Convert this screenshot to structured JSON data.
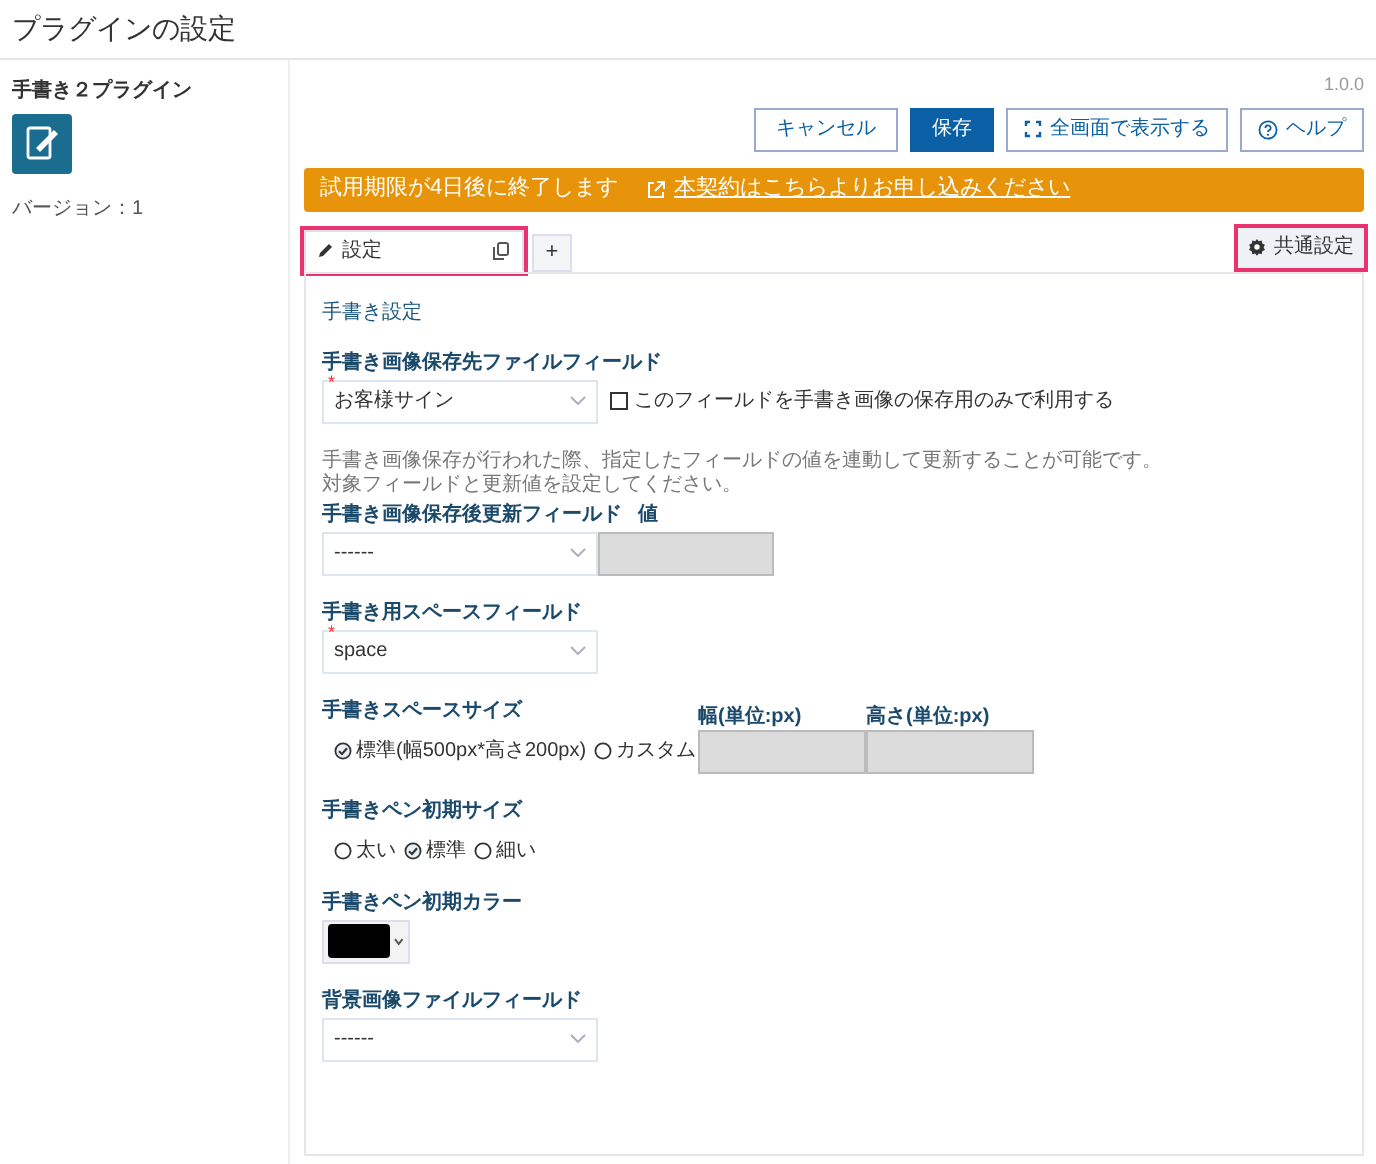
{
  "page_title": "プラグインの設定",
  "plugin": {
    "name": "手書き２プラグイン",
    "version": "バージョン：1"
  },
  "version_number": "1.0.0",
  "buttons": [
    {
      "label": "キャンセル",
      "kind": "default"
    },
    {
      "label": "保存",
      "kind": "primary"
    },
    {
      "label": "全画面で表示する",
      "kind": "fullscreen"
    },
    {
      "label": "ヘルプ",
      "kind": "help"
    }
  ],
  "notice": {
    "text": "試用期限が4日後に終了します",
    "link": "本契約はこちらよりお申し込みください"
  },
  "tabs": [
    {
      "label": "設定",
      "kind": "tab",
      "selected": true,
      "highlighted": true
    },
    {
      "label": "+",
      "kind": "add",
      "selected": false,
      "highlighted": false
    }
  ],
  "common_settings": {
    "label": "共通設定",
    "highlighted": true
  },
  "section_title": "手書き設定",
  "fields": [
    {
      "kind": "select",
      "label": "手書き画像保存先ファイルフィールド",
      "required_mark": "*",
      "value": "お客様サイン",
      "checkbox": {
        "label": "このフィールドを手書き画像の保存用のみで利用する",
        "checked": false
      }
    },
    {
      "kind": "note",
      "lines": [
        "手書き画像保存が行われた際、指定したフィールドの値を連動して更新することが可能です。",
        "対象フィールドと更新値を設定してください。"
      ]
    },
    {
      "kind": "select_value",
      "label": "手書き画像保存後更新フィールド",
      "value": "------",
      "value_label": "値"
    },
    {
      "kind": "select",
      "label": "手書き用スペースフィールド",
      "required_mark": "*",
      "value": "space"
    },
    {
      "kind": "radio_size",
      "label": "手書きスペースサイズ",
      "options": [
        {
          "label": "標準(幅500px*高さ200px)",
          "selected": true
        },
        {
          "label": "カスタム",
          "selected": false
        }
      ],
      "inputs": [
        {
          "label": "幅(単位:px)",
          "disabled": true
        },
        {
          "label": "高さ(単位:px)",
          "disabled": true
        }
      ]
    },
    {
      "kind": "radio",
      "label": "手書きペン初期サイズ",
      "options": [
        {
          "label": "太い",
          "selected": false
        },
        {
          "label": "標準",
          "selected": true
        },
        {
          "label": "細い",
          "selected": false
        }
      ]
    },
    {
      "kind": "color",
      "label": "手書きペン初期カラー",
      "color": "#000000"
    },
    {
      "kind": "select",
      "label": "背景画像ファイルフィールド",
      "value": "------"
    }
  ]
}
